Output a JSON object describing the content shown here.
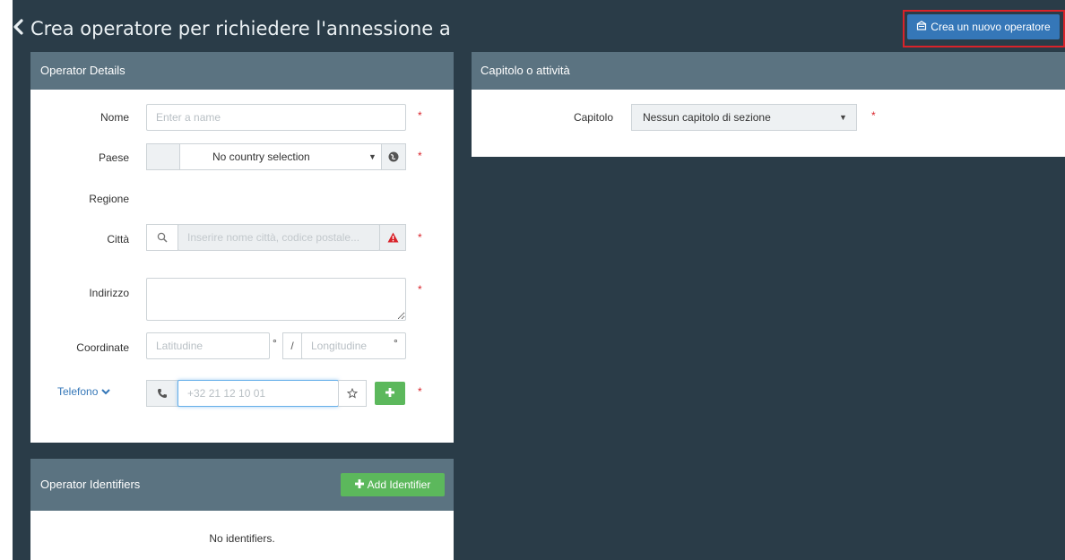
{
  "header": {
    "title": "Crea operatore per richiedere l'annessione a",
    "back_icon": "chevron-left-icon",
    "create_button_label": "Crea un nuovo operatore",
    "create_button_icon": "building-icon"
  },
  "operator_details": {
    "heading": "Operator Details",
    "required_marker": "*",
    "fields": {
      "nome": {
        "label": "Nome",
        "placeholder": "Enter a name"
      },
      "paese": {
        "label": "Paese",
        "selected": "No country selection",
        "icon": "globe-icon"
      },
      "regione": {
        "label": "Regione"
      },
      "citta": {
        "label": "Città",
        "placeholder": "Inserire nome città, codice postale...",
        "search_icon": "search-icon",
        "warning_icon": "warning-triangle-icon"
      },
      "indirizzo": {
        "label": "Indirizzo"
      },
      "coordinate": {
        "label": "Coordinate",
        "lat_placeholder": "Latitudine",
        "lon_placeholder": "Longitudine",
        "degree": "°",
        "separator": "/"
      },
      "telefono": {
        "label": "Telefono",
        "placeholder": "+32 21 12 10 01",
        "phone_icon": "phone-icon",
        "star_icon": "star-icon",
        "add_icon": "plus-icon"
      }
    }
  },
  "operator_identifiers": {
    "heading": "Operator Identifiers",
    "add_button_label": "Add Identifier",
    "empty_text": "No identifiers."
  },
  "chapter": {
    "heading": "Capitolo o attività",
    "label": "Capitolo",
    "selected": "Nessun capitolo di sezione",
    "required_marker": "*"
  },
  "colors": {
    "background": "#2a3c48",
    "panel_header": "#5b7381",
    "primary": "#3577b8",
    "success": "#5cb85c",
    "required": "#d9232a"
  }
}
